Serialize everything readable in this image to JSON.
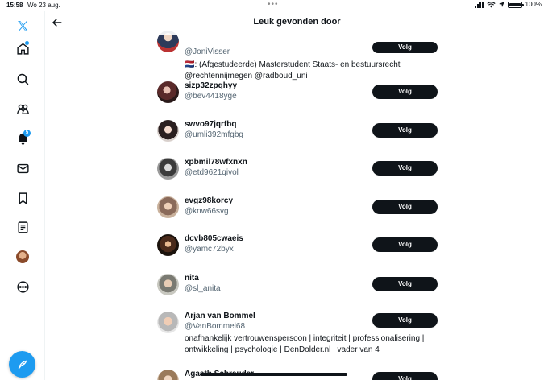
{
  "status_bar": {
    "time": "15:58",
    "date": "Wo 23 aug.",
    "battery": "100%"
  },
  "nav": {
    "items": [
      "x-logo",
      "home-icon",
      "search-icon",
      "communities-icon",
      "notifications-icon",
      "messages-icon",
      "bookmarks-icon",
      "lists-icon",
      "profile-avatar",
      "more-icon"
    ],
    "notifications_badge": "5"
  },
  "header": {
    "title": "Leuk gevonden door"
  },
  "users": [
    {
      "name": "",
      "handle": "@JoniVisser",
      "bio": "🇳🇱: (Afgestudeerde) Masterstudent Staats- en bestuursrecht @rechtennijmegen @radboud_uni",
      "follow_label": "Volg"
    },
    {
      "name": "sizp32zpqhyy",
      "handle": "@bev4418yge",
      "bio": "",
      "follow_label": "Volg"
    },
    {
      "name": "swvo97jqrfbq",
      "handle": "@umli392mfgbg",
      "bio": "",
      "follow_label": "Volg"
    },
    {
      "name": "xpbmil78wfxnxn",
      "handle": "@etd9621qivol",
      "bio": "",
      "follow_label": "Volg"
    },
    {
      "name": "evgz98korcy",
      "handle": "@knw66svg",
      "bio": "",
      "follow_label": "Volg"
    },
    {
      "name": "dcvb805cwaeis",
      "handle": "@yamc72byx",
      "bio": "",
      "follow_label": "Volg"
    },
    {
      "name": "nita",
      "handle": "@sl_anita",
      "bio": "",
      "follow_label": "Volg"
    },
    {
      "name": "Arjan van Bommel",
      "handle": "@VanBommel68",
      "bio": "onafhankelijk vertrouwenspersoon | integriteit | professionalisering | ontwikkeling | psychologie | DenDolder.nl | vader van 4",
      "follow_label": "Volg"
    },
    {
      "name": "Agaath Schreuder",
      "handle": "",
      "bio": "",
      "follow_label": "Volg"
    }
  ],
  "colors": {
    "accent": "#1d9bf0",
    "text": "#0f1419",
    "secondary": "#536471",
    "button": "#0f1419"
  }
}
